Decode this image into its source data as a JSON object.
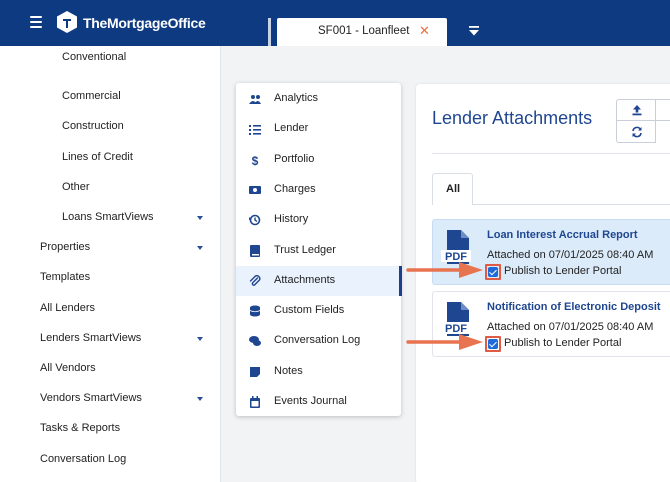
{
  "app": {
    "brand": "TheMortgageOffice",
    "tab_label": "SF001 - Loanfleet",
    "tab_close": "✕"
  },
  "sidebar": {
    "items": [
      {
        "label": "Conventional",
        "has_caret": false,
        "indent": true
      },
      {
        "label": "Commercial",
        "has_caret": false,
        "indent": true
      },
      {
        "label": "Construction",
        "has_caret": false,
        "indent": true
      },
      {
        "label": "Lines of Credit",
        "has_caret": false,
        "indent": true
      },
      {
        "label": "Other",
        "has_caret": false,
        "indent": true
      },
      {
        "label": "Loans SmartViews",
        "has_caret": true,
        "indent": true
      },
      {
        "label": "Properties",
        "has_caret": true,
        "indent": false
      },
      {
        "label": "Templates",
        "has_caret": false,
        "indent": false
      },
      {
        "label": "All Lenders",
        "has_caret": false,
        "indent": false
      },
      {
        "label": "Lenders SmartViews",
        "has_caret": true,
        "indent": false
      },
      {
        "label": "All Vendors",
        "has_caret": false,
        "indent": false
      },
      {
        "label": "Vendors SmartViews",
        "has_caret": true,
        "indent": false
      },
      {
        "label": "Tasks & Reports",
        "has_caret": false,
        "indent": false
      },
      {
        "label": "Conversation Log",
        "has_caret": false,
        "indent": false
      }
    ]
  },
  "menu": {
    "items": [
      {
        "label": "Analytics",
        "icon": "users-icon"
      },
      {
        "label": "Lender",
        "icon": "list-icon"
      },
      {
        "label": "Portfolio",
        "icon": "dollar-icon"
      },
      {
        "label": "Charges",
        "icon": "money-bill-icon"
      },
      {
        "label": "History",
        "icon": "history-icon"
      },
      {
        "label": "Trust Ledger",
        "icon": "book-icon"
      },
      {
        "label": "Attachments",
        "icon": "paperclip-icon",
        "active": true
      },
      {
        "label": "Custom Fields",
        "icon": "database-icon"
      },
      {
        "label": "Conversation Log",
        "icon": "comments-icon"
      },
      {
        "label": "Notes",
        "icon": "sticky-note-icon"
      },
      {
        "label": "Events Journal",
        "icon": "calendar-icon"
      }
    ]
  },
  "panel": {
    "title": "Lender Attachments",
    "tab_all": "All",
    "attachments": [
      {
        "title": "Loan Interest Accrual Report",
        "meta": "Attached on 07/01/2025 08:40 AM",
        "publish_label": "Publish to Lender Portal",
        "published": true,
        "selected": true
      },
      {
        "title": "Notification of Electronic Deposit",
        "meta": "Attached on 07/01/2025 08:40 AM",
        "publish_label": "Publish to Lender Portal",
        "published": true,
        "selected": false
      }
    ]
  },
  "colors": {
    "topbar": "#0e3a82",
    "accent": "#1f4690",
    "annotation": "#e8734f",
    "selected_card": "#dcebfa"
  }
}
